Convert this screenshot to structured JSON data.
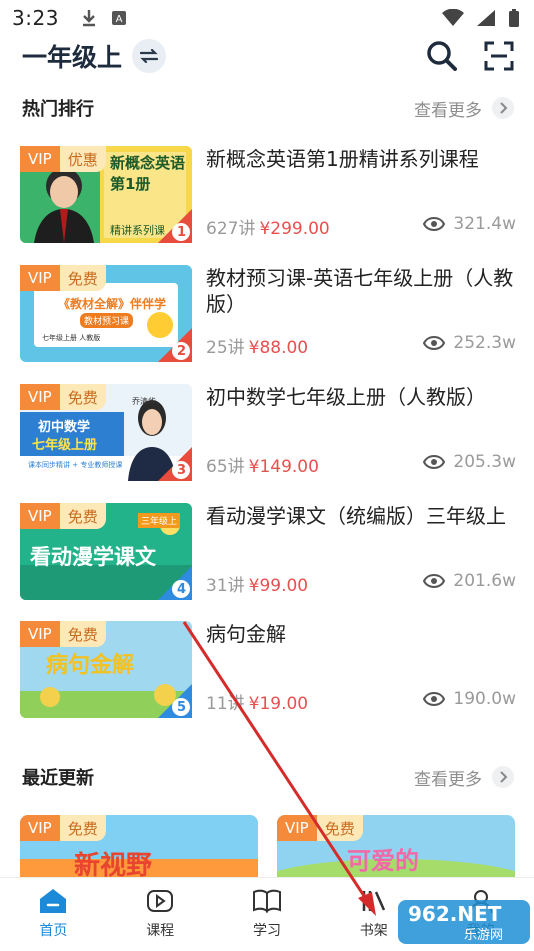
{
  "status_bar": {
    "time": "3:23"
  },
  "header": {
    "grade": "一年级上"
  },
  "hot_section": {
    "title": "热门排行",
    "more": "查看更多"
  },
  "courses": [
    {
      "vip": "VIP",
      "tag": "优惠",
      "title": "新概念英语第1册精讲系列课程",
      "lessons": "627讲",
      "price": "¥299.00",
      "views": "321.4w",
      "rank": "1",
      "thumb_text": "新概念英语第1册",
      "thumb_sub": "精讲系列课"
    },
    {
      "vip": "VIP",
      "tag": "免费",
      "title": "教材预习课-英语七年级上册（人教版）",
      "lessons": "25讲",
      "price": "¥88.00",
      "views": "252.3w",
      "rank": "2",
      "thumb_text": "《教材全解》伴伴学",
      "thumb_sub": "教材预习课",
      "thumb_sub2": "七年级上册 人教版"
    },
    {
      "vip": "VIP",
      "tag": "免费",
      "title": "初中数学七年级上册（人教版）",
      "lessons": "65讲",
      "price": "¥149.00",
      "views": "205.3w",
      "rank": "3",
      "thumb_text": "初中数学",
      "thumb_sub": "七年级上册",
      "thumb_sub2": "课本同步精讲 + 专业教师授课",
      "thumb_name": "乔清华"
    },
    {
      "vip": "VIP",
      "tag": "免费",
      "title": "看动漫学课文（统编版）三年级上",
      "lessons": "31讲",
      "price": "¥99.00",
      "views": "201.6w",
      "rank": "4",
      "thumb_text": "看动漫学课文",
      "thumb_sub": "三年级上"
    },
    {
      "vip": "VIP",
      "tag": "免费",
      "title": "病句金解",
      "lessons": "11讲",
      "price": "¥19.00",
      "views": "190.0w",
      "rank": "5",
      "thumb_text": "病句金解"
    }
  ],
  "recent_section": {
    "title": "最近更新",
    "more": "查看更多"
  },
  "recent_cards": [
    {
      "vip": "VIP",
      "tag": "免费",
      "thumb_text": "新视野"
    },
    {
      "vip": "VIP",
      "tag": "免费",
      "thumb_text": "可爱的"
    }
  ],
  "bottom_nav": [
    {
      "label": "首页"
    },
    {
      "label": "课程"
    },
    {
      "label": "学习"
    },
    {
      "label": "书架"
    },
    {
      "label": "我的"
    }
  ],
  "watermark": {
    "text": "962.NET",
    "sub": "乐游网"
  },
  "colors": {
    "accent": "#1c8ad9",
    "price": "#e8504f",
    "vip": "#f58a3a"
  }
}
